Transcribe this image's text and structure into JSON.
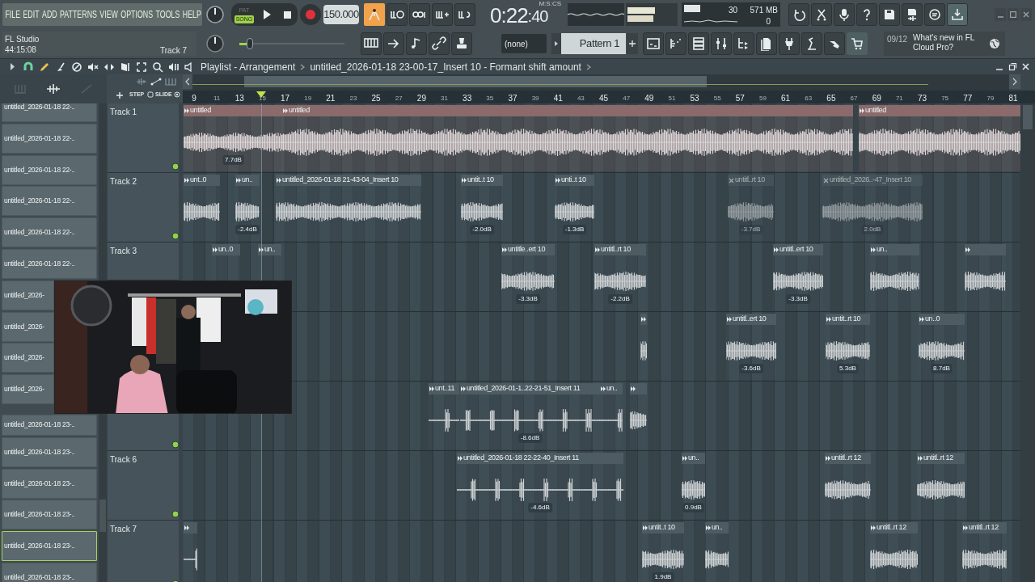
{
  "menu": [
    "FILE",
    "EDIT",
    "ADD",
    "PATTERNS",
    "VIEW",
    "OPTIONS",
    "TOOLS",
    "HELP"
  ],
  "modes": [
    {
      "label": "PAT",
      "selected": false
    },
    {
      "label": "SONG",
      "selected": true
    }
  ],
  "tempo": "150.000",
  "time": {
    "value": "0:22",
    "fraction": ":40",
    "format": "M:S:CS"
  },
  "cpu": {
    "polyphony": "30",
    "memory": "571 MB",
    "voices": "0"
  },
  "hint": {
    "title": "FL Studio",
    "time": "44:15:08",
    "target": "Track 7"
  },
  "pitch_slider": {
    "level": 0.1
  },
  "pattern": {
    "channel": "(none)",
    "name": "Pattern 1"
  },
  "news": {
    "index": "09/12",
    "text": "What's new in FL Cloud Pro?"
  },
  "playlist": {
    "title": "Playlist - Arrangement",
    "path": "untitled_2026-01-18 23-00-17_Insert 10 - Formant shift amount"
  },
  "step_labels": [
    "STEP",
    "SLIDE"
  ],
  "ruler": [
    "9",
    "11",
    "13",
    "15",
    "17",
    "19",
    "21",
    "23",
    "25",
    "27",
    "29",
    "31",
    "33",
    "35",
    "37",
    "39",
    "41",
    "43",
    "45",
    "47",
    "49",
    "51",
    "53",
    "55",
    "57",
    "59",
    "61",
    "63",
    "65",
    "67",
    "69",
    "71",
    "73",
    "75",
    "77",
    "79",
    "81"
  ],
  "browser": [
    {
      "label": "untitled_2026-01-18 22-..",
      "selected": false
    },
    {
      "label": "untitled_2026-01-18 22-..",
      "selected": false
    },
    {
      "label": "untitled_2026-01-18 22-..",
      "selected": false
    },
    {
      "label": "untitled_2026-01-18 22-..",
      "selected": false
    },
    {
      "label": "untitled_2026-01-18 22-..",
      "selected": false
    },
    {
      "label": "untitled_2026-01-18 22-..",
      "selected": false
    },
    {
      "label": "untitled_2026-",
      "selected": false
    },
    {
      "label": "untitled_2026-",
      "selected": false
    },
    {
      "label": "untitled_2026-",
      "selected": false
    },
    {
      "label": "untitled_2026-",
      "selected": false
    },
    {
      "label": "untitled_2026-01-18 23-..",
      "selected": false
    },
    {
      "label": "untitled_2026-01-18 23-..",
      "selected": false
    },
    {
      "label": "untitled_2026-01-18 23-..",
      "selected": false
    },
    {
      "label": "untitled_2026-01-18 23-..",
      "selected": false
    },
    {
      "label": "untitled_2026-01-18 23-..",
      "selected": true
    },
    {
      "label": "untitled_2026-01-18 23-..",
      "selected": false
    }
  ],
  "tracks": [
    {
      "name": "Track 1",
      "color": "#8a6a6b",
      "clips": [
        {
          "label": "untitled",
          "gain": "7.7dB",
          "muted": false
        },
        {
          "label": "untitled",
          "muted": false
        },
        {
          "label": "untitled",
          "muted": false
        }
      ]
    },
    {
      "name": "Track 2",
      "color": "#4d5b63",
      "clips": [
        {
          "label": "unt..0",
          "muted": false
        },
        {
          "label": "un..",
          "gain": "-2.4dB",
          "muted": false
        },
        {
          "label": "untitled_2026-01-18 21-43-04_Insert 10",
          "muted": false
        },
        {
          "label": "untit..t 10",
          "gain": "-2.0dB",
          "muted": false
        },
        {
          "label": "unti..t 10",
          "gain": "-1.3dB",
          "muted": false
        },
        {
          "label": "untitl..rt 10",
          "gain": "-3.7dB",
          "muted": true
        },
        {
          "label": "untitled_2026..-47_Insert 10",
          "gain": "2.0dB",
          "muted": true
        }
      ]
    },
    {
      "name": "Track 3",
      "color": "#4d5b63",
      "clips": [
        {
          "label": "un..0",
          "muted": false
        },
        {
          "label": "un..",
          "muted": false
        },
        {
          "label": "untitle..ert 10",
          "gain": "-3.3dB",
          "muted": false
        },
        {
          "label": "untitl..rt 10",
          "gain": "-2.2dB",
          "muted": false
        },
        {
          "label": "untitl..ert 10",
          "gain": "-3.3dB",
          "muted": false
        },
        {
          "label": "un..",
          "muted": false
        },
        {
          "muted": false
        }
      ]
    },
    {
      "color": "#4d5b63",
      "clips": [
        {
          "muted": false
        },
        {
          "label": "untitl..ert 10",
          "gain": "-3.6dB",
          "muted": false
        },
        {
          "label": "untit..rt 10",
          "gain": "5.3dB",
          "muted": false
        },
        {
          "label": "un..0",
          "gain": "8.7dB",
          "muted": false
        }
      ]
    },
    {
      "color": "#4d5b63",
      "clips": [
        {
          "label": "unt..11",
          "muted": false
        },
        {
          "label": "untitled_2026-01-1..22-21-51_Insert 11",
          "gain": "-8.6dB",
          "muted": false
        },
        {
          "label": "un..",
          "muted": false
        },
        {
          "muted": false
        }
      ]
    },
    {
      "name": "Track 6",
      "color": "#4d5b63",
      "clips": [
        {
          "label": "untitled_2026-01-18 22-22-40_Insert 11",
          "gain": "-4.6dB",
          "muted": false
        },
        {
          "label": "un..",
          "gain": "0.9dB",
          "muted": false
        },
        {
          "label": "untitl..rt 12",
          "muted": false
        },
        {
          "label": "untitl..rt 12",
          "muted": false
        }
      ]
    },
    {
      "name": "Track 7",
      "color": "#4d5b63",
      "clips": [
        {
          "muted": false
        },
        {
          "label": "untit..t 10",
          "gain": "1.9dB",
          "muted": false
        },
        {
          "label": "un..",
          "muted": false
        },
        {
          "label": "untitl..rt 12",
          "muted": false
        },
        {
          "label": "untitl..rt 12",
          "muted": false
        }
      ]
    }
  ]
}
